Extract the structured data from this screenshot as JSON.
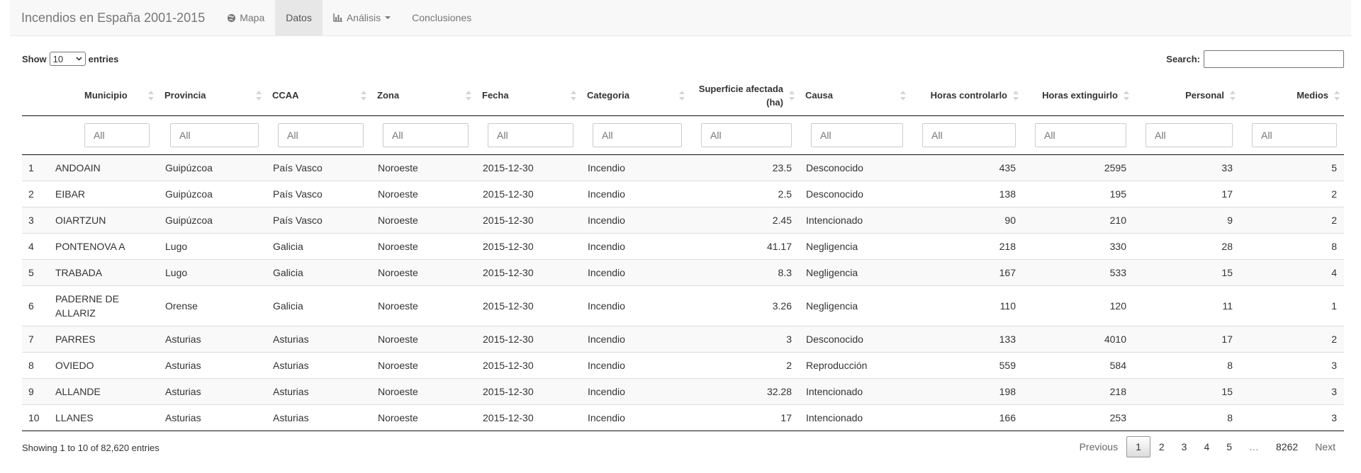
{
  "navbar": {
    "brand": "Incendios en España 2001-2015",
    "tabs": [
      {
        "label": "Mapa",
        "icon": "globe-icon"
      },
      {
        "label": "Datos",
        "active": true
      },
      {
        "label": "Análisis",
        "icon": "bar-chart-icon",
        "dropdown": true
      },
      {
        "label": "Conclusiones"
      }
    ]
  },
  "controls": {
    "show_label": "Show",
    "entries_label": "entries",
    "length_value": "10",
    "search_label": "Search:",
    "search_value": ""
  },
  "table": {
    "columns": [
      "Municipio",
      "Provincia",
      "CCAA",
      "Zona",
      "Fecha",
      "Categoria",
      "Superficie afectada (ha)",
      "Causa",
      "Horas controlarlo",
      "Horas extinguirlo",
      "Personal",
      "Medios"
    ],
    "filter_placeholder": "All",
    "rows": [
      [
        "1",
        "ANDOAIN",
        "Guipúzcoa",
        "País Vasco",
        "Noroeste",
        "2015-12-30",
        "Incendio",
        "23.5",
        "Desconocido",
        "435",
        "2595",
        "33",
        "5"
      ],
      [
        "2",
        "EIBAR",
        "Guipúzcoa",
        "País Vasco",
        "Noroeste",
        "2015-12-30",
        "Incendio",
        "2.5",
        "Desconocido",
        "138",
        "195",
        "17",
        "2"
      ],
      [
        "3",
        "OIARTZUN",
        "Guipúzcoa",
        "País Vasco",
        "Noroeste",
        "2015-12-30",
        "Incendio",
        "2.45",
        "Intencionado",
        "90",
        "210",
        "9",
        "2"
      ],
      [
        "4",
        "PONTENOVA A",
        "Lugo",
        "Galicia",
        "Noroeste",
        "2015-12-30",
        "Incendio",
        "41.17",
        "Negligencia",
        "218",
        "330",
        "28",
        "8"
      ],
      [
        "5",
        "TRABADA",
        "Lugo",
        "Galicia",
        "Noroeste",
        "2015-12-30",
        "Incendio",
        "8.3",
        "Negligencia",
        "167",
        "533",
        "15",
        "4"
      ],
      [
        "6",
        "PADERNE DE ALLARIZ",
        "Orense",
        "Galicia",
        "Noroeste",
        "2015-12-30",
        "Incendio",
        "3.26",
        "Negligencia",
        "110",
        "120",
        "11",
        "1"
      ],
      [
        "7",
        "PARRES",
        "Asturias",
        "Asturias",
        "Noroeste",
        "2015-12-30",
        "Incendio",
        "3",
        "Desconocido",
        "133",
        "4010",
        "17",
        "2"
      ],
      [
        "8",
        "OVIEDO",
        "Asturias",
        "Asturias",
        "Noroeste",
        "2015-12-30",
        "Incendio",
        "2",
        "Reproducción",
        "559",
        "584",
        "8",
        "3"
      ],
      [
        "9",
        "ALLANDE",
        "Asturias",
        "Asturias",
        "Noroeste",
        "2015-12-30",
        "Incendio",
        "32.28",
        "Intencionado",
        "198",
        "218",
        "15",
        "3"
      ],
      [
        "10",
        "LLANES",
        "Asturias",
        "Asturias",
        "Noroeste",
        "2015-12-30",
        "Incendio",
        "17",
        "Intencionado",
        "166",
        "253",
        "8",
        "3"
      ]
    ]
  },
  "footer": {
    "info": "Showing 1 to 10 of 82,620 entries",
    "pagination": {
      "previous": "Previous",
      "pages": [
        "1",
        "2",
        "3",
        "4",
        "5"
      ],
      "ellipsis": "…",
      "last": "8262",
      "next": "Next",
      "current": "1"
    }
  }
}
